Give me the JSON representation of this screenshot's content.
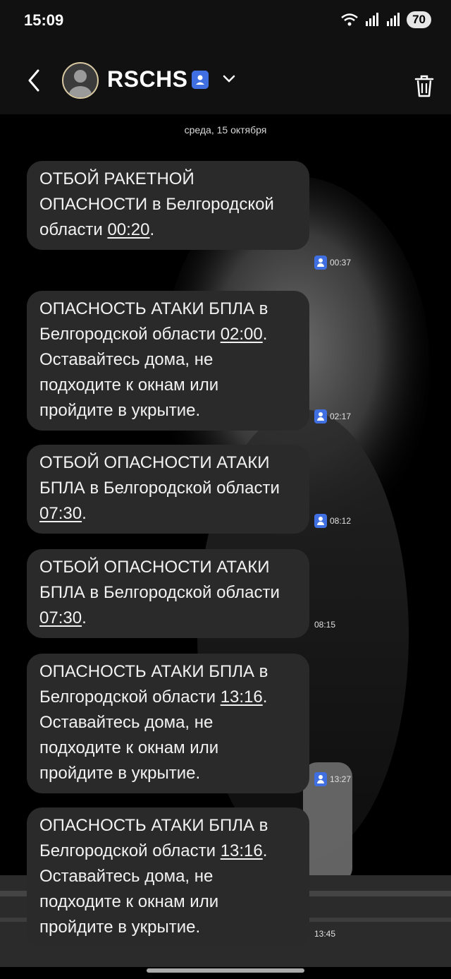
{
  "status_bar": {
    "time": "15:09",
    "battery": "70"
  },
  "header": {
    "contact_name": "RSCHS"
  },
  "conversation": {
    "date": "среда, 15 октября",
    "messages": [
      {
        "pre": "ОТБОЙ РАКЕТНОЙ ОПАСНОСТИ в Белгородской области ",
        "time_link": "00:20",
        "post": ".",
        "received": "00:37",
        "sim": true
      },
      {
        "pre": "ОПАСНОСТЬ АТАКИ БПЛА в Белгородской области ",
        "time_link": "02:00",
        "post": ". Оставайтесь дома, не подходите к окнам или пройдите в укрытие.",
        "received": "02:17",
        "sim": true
      },
      {
        "pre": "ОТБОЙ ОПАСНОСТИ АТАКИ БПЛА в Белгородской области ",
        "time_link": "07:30",
        "post": ".",
        "received": "08:12",
        "sim": true
      },
      {
        "pre": "ОТБОЙ ОПАСНОСТИ АТАКИ БПЛА в Белгородской области ",
        "time_link": "07:30",
        "post": ".",
        "received": "08:15",
        "sim": false
      },
      {
        "pre": "ОПАСНОСТЬ АТАКИ БПЛА в Белгородской области ",
        "time_link": "13:16",
        "post": ". Оставайтесь дома, не подходите к окнам или пройдите в укрытие.",
        "received": "13:27",
        "sim": true
      },
      {
        "pre": "ОПАСНОСТЬ АТАКИ БПЛА в Белгородской области ",
        "time_link": "13:16",
        "post": ". Оставайтесь дома, не подходите к окнам или пройдите в укрытие.",
        "received": "13:45",
        "sim": false
      }
    ]
  },
  "icons": {
    "back": "back-arrow-icon",
    "avatar": "person-avatar-icon",
    "badge": "contact-card-icon",
    "chevron": "chevron-down-icon",
    "trash": "trash-icon",
    "sim": "sim-profile-icon"
  },
  "colors": {
    "bubble": "#2a2a2a",
    "accent": "#3f6fe0",
    "background": "#000000"
  }
}
